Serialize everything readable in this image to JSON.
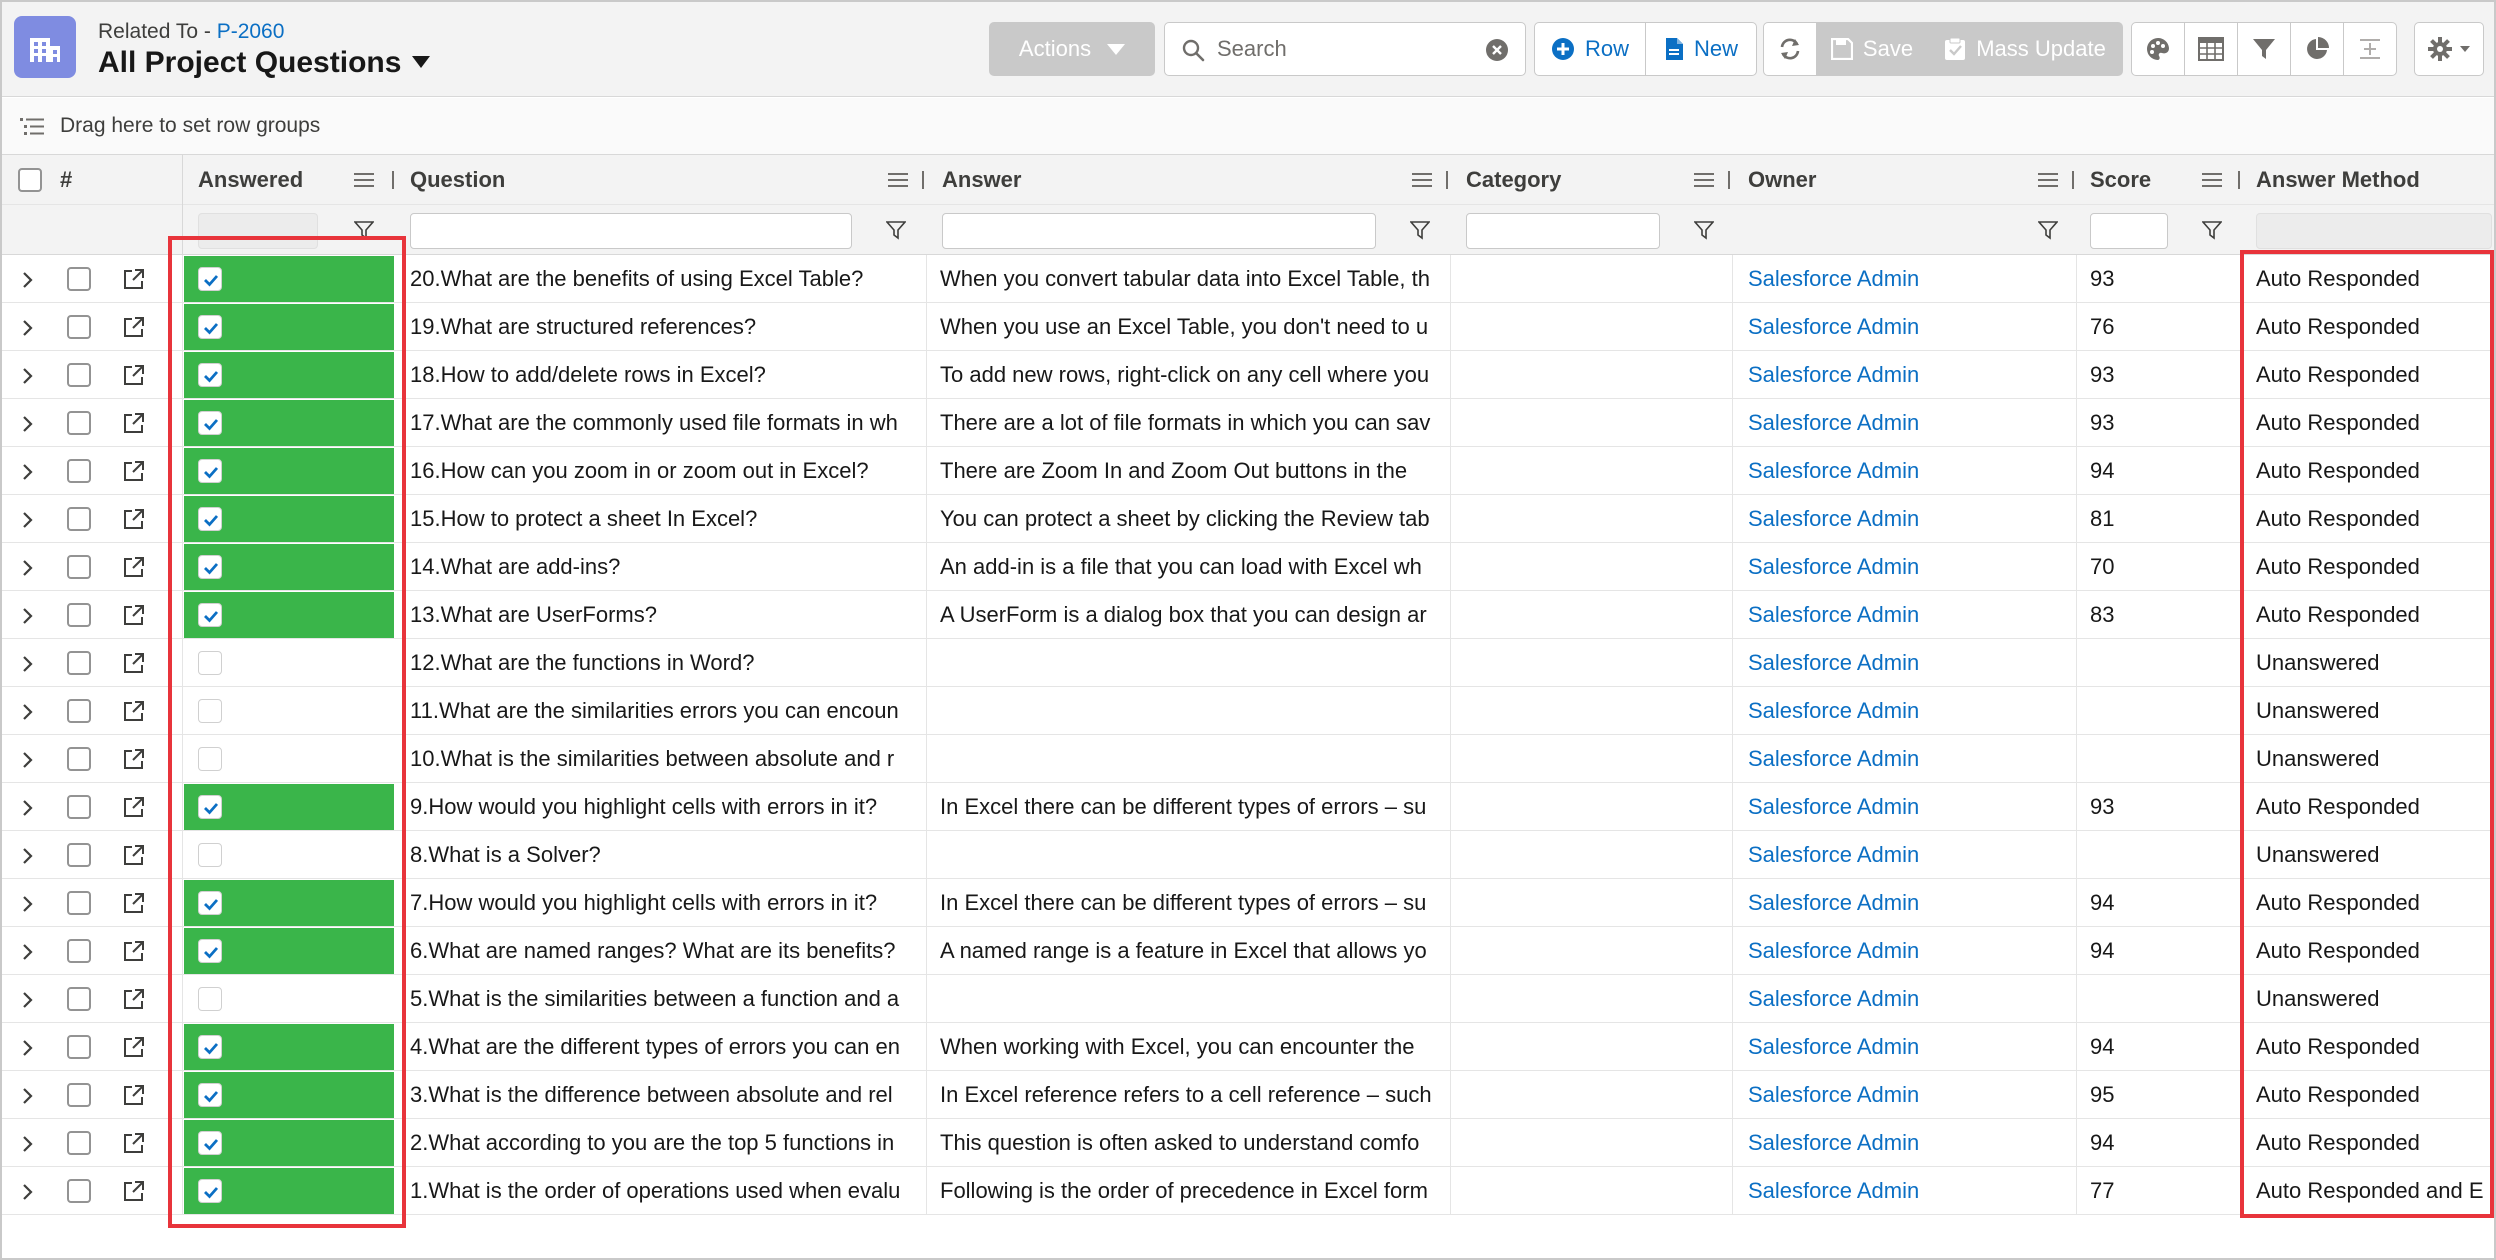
{
  "header": {
    "related_prefix": "Related To - ",
    "related_link": "P-2060",
    "title": "All Project Questions",
    "actions_label": "Actions",
    "search_placeholder": "Search",
    "row_label": "Row",
    "new_label": "New",
    "save_label": "Save",
    "mass_update_label": "Mass Update"
  },
  "rowgroup": {
    "text": "Drag here to set row groups"
  },
  "columns": {
    "index": "#",
    "answered": "Answered",
    "question": "Question",
    "answer": "Answer",
    "category": "Category",
    "owner": "Owner",
    "score": "Score",
    "answer_method": "Answer Method"
  },
  "colors": {
    "answered_green": "#3ab54a",
    "link_blue": "#0b6fc4",
    "highlight_red": "#e8343b",
    "app_icon": "#7f8ce1"
  },
  "rows": [
    {
      "answered": true,
      "question": "20.What are the benefits of using Excel Table?",
      "answer": "When you convert tabular data into Excel Table, th",
      "category": "",
      "owner": "Salesforce Admin",
      "score": "93",
      "method": "Auto Responded"
    },
    {
      "answered": true,
      "question": "19.What are structured references?",
      "answer": "When you use an Excel Table, you don't need to u",
      "category": "",
      "owner": "Salesforce Admin",
      "score": "76",
      "method": "Auto Responded"
    },
    {
      "answered": true,
      "question": "18.How to add/delete rows in Excel?",
      "answer": "To add new rows, right-click on any cell where you",
      "category": "",
      "owner": "Salesforce Admin",
      "score": "93",
      "method": "Auto Responded"
    },
    {
      "answered": true,
      "question": "17.What are the commonly used file formats in wh",
      "answer": "There are a lot of file formats in which you can sav",
      "category": "",
      "owner": "Salesforce Admin",
      "score": "93",
      "method": "Auto Responded"
    },
    {
      "answered": true,
      "question": "16.How can you zoom in or zoom out in Excel?",
      "answer": "There are Zoom In and Zoom Out buttons in the",
      "category": "",
      "owner": "Salesforce Admin",
      "score": "94",
      "method": "Auto Responded"
    },
    {
      "answered": true,
      "question": "15.How to protect a sheet In Excel?",
      "answer": "You can protect a sheet by clicking the Review tab",
      "category": "",
      "owner": "Salesforce Admin",
      "score": "81",
      "method": "Auto Responded"
    },
    {
      "answered": true,
      "question": "14.What are add-ins?",
      "answer": "An add-in is a file that you can load with Excel wh",
      "category": "",
      "owner": "Salesforce Admin",
      "score": "70",
      "method": "Auto Responded"
    },
    {
      "answered": true,
      "question": "13.What are UserForms?",
      "answer": "A UserForm is a dialog box that you can design ar",
      "category": "",
      "owner": "Salesforce Admin",
      "score": "83",
      "method": "Auto Responded"
    },
    {
      "answered": false,
      "question": "12.What are the functions in Word?",
      "answer": "",
      "category": "",
      "owner": "Salesforce Admin",
      "score": "",
      "method": "Unanswered"
    },
    {
      "answered": false,
      "question": "11.What are the similarities errors you can encoun",
      "answer": "",
      "category": "",
      "owner": "Salesforce Admin",
      "score": "",
      "method": "Unanswered"
    },
    {
      "answered": false,
      "question": "10.What is the similarities between absolute and r",
      "answer": "",
      "category": "",
      "owner": "Salesforce Admin",
      "score": "",
      "method": "Unanswered"
    },
    {
      "answered": true,
      "question": "9.How would you highlight cells with errors in it?",
      "answer": "In Excel there can be different types of errors – su",
      "category": "",
      "owner": "Salesforce Admin",
      "score": "93",
      "method": "Auto Responded"
    },
    {
      "answered": false,
      "question": "8.What is a Solver?",
      "answer": "",
      "category": "",
      "owner": "Salesforce Admin",
      "score": "",
      "method": "Unanswered"
    },
    {
      "answered": true,
      "question": "7.How would you highlight cells with errors in it?",
      "answer": "In Excel there can be different types of errors – su",
      "category": "",
      "owner": "Salesforce Admin",
      "score": "94",
      "method": "Auto Responded"
    },
    {
      "answered": true,
      "question": "6.What are named ranges? What are its benefits?",
      "answer": "A named range is a feature in Excel that allows yo",
      "category": "",
      "owner": "Salesforce Admin",
      "score": "94",
      "method": "Auto Responded"
    },
    {
      "answered": false,
      "question": "5.What is the similarities between a function and a",
      "answer": "",
      "category": "",
      "owner": "Salesforce Admin",
      "score": "",
      "method": "Unanswered"
    },
    {
      "answered": true,
      "question": "4.What are the different types of errors you can en",
      "answer": "When working with Excel, you can encounter the",
      "category": "",
      "owner": "Salesforce Admin",
      "score": "94",
      "method": "Auto Responded"
    },
    {
      "answered": true,
      "question": "3.What is the difference between absolute and rel",
      "answer": "In Excel reference refers to a cell reference – such",
      "category": "",
      "owner": "Salesforce Admin",
      "score": "95",
      "method": "Auto Responded"
    },
    {
      "answered": true,
      "question": "2.What according to you are the top 5 functions in",
      "answer": "This question is often asked to understand comfo",
      "category": "",
      "owner": "Salesforce Admin",
      "score": "94",
      "method": "Auto Responded"
    },
    {
      "answered": true,
      "question": "1.What is the order of operations used when evalu",
      "answer": "Following is the order of precedence in Excel form",
      "category": "",
      "owner": "Salesforce Admin",
      "score": "77",
      "method": "Auto Responded and E"
    }
  ]
}
